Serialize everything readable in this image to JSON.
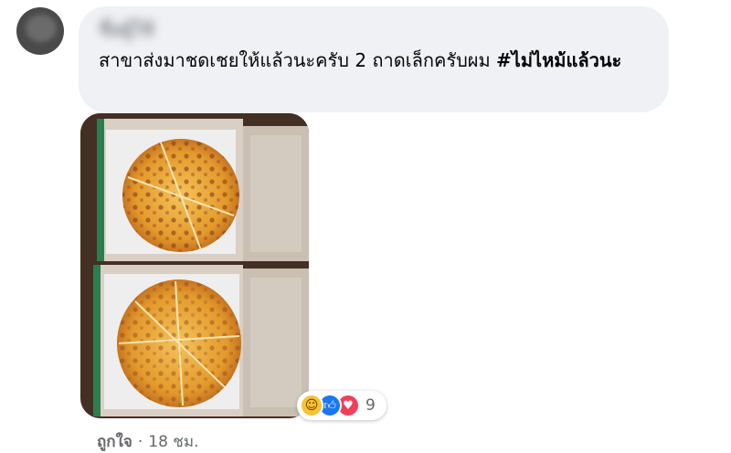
{
  "comment": {
    "author_name": "ชื่อผู้ใช้",
    "text": "สาขาส่งมาชดเชยให้แล้วนะครับ 2 ถาดเล็กครับผม ",
    "hashtag": "#ไม่ไหม้แล้วนะ"
  },
  "reactions": {
    "icons": [
      "haha-icon",
      "like-icon",
      "love-icon"
    ],
    "count": "9"
  },
  "meta": {
    "like_label": "ถูกใจ",
    "separator": "·",
    "timestamp": "18 ชม."
  },
  "colors": {
    "bubble": "#eff1f4",
    "like_blue": "#1877f2",
    "love_red": "#f33e58",
    "haha_yellow": "#f7c233",
    "secondary_text": "#65676b"
  }
}
